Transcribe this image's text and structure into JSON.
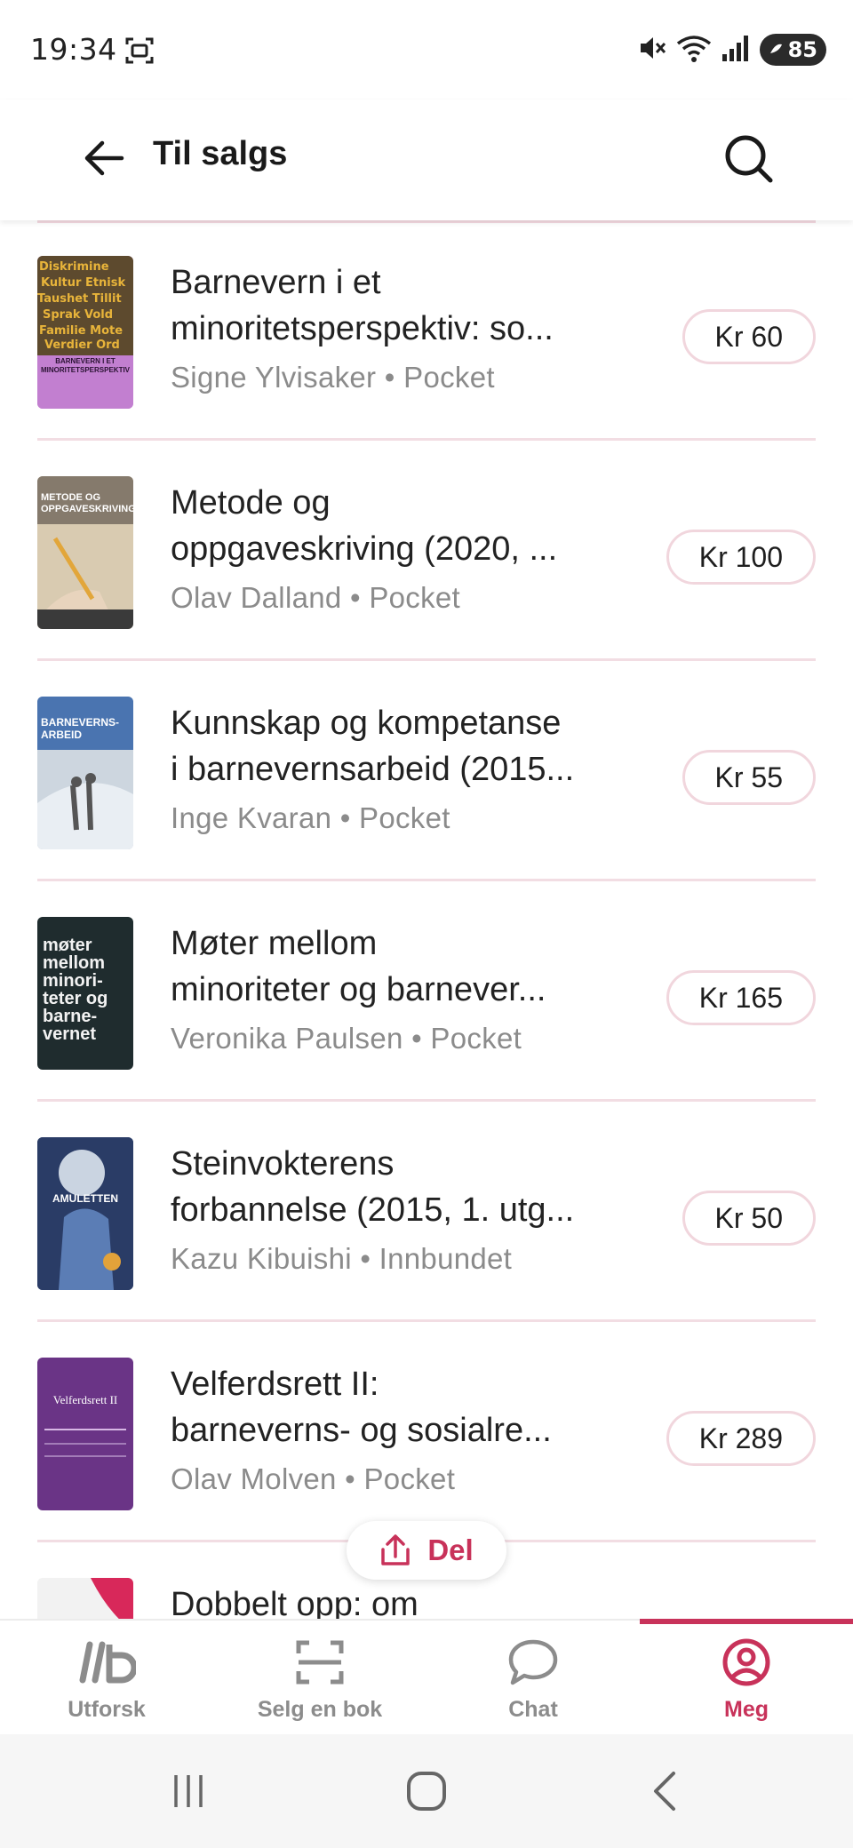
{
  "status_bar": {
    "time": "19:34",
    "battery": "85",
    "icons": [
      "screenshot-icon",
      "mute-icon",
      "wifi-icon",
      "signal-icon",
      "battery-icon"
    ]
  },
  "header": {
    "title": "Til salgs",
    "back_icon": "arrow-left-icon",
    "search_icon": "search-icon"
  },
  "books": [
    {
      "title": "Barnevern i et\nminoritetsperspektiv: so...",
      "author": "Signe Ylvisaker",
      "format": "Pocket",
      "subtitle": "Signe Ylvisaker • Pocket",
      "price": "Kr 60",
      "cover_color": "#b26cc4"
    },
    {
      "title": "Metode og\noppgaveskriving (2020, ...",
      "author": "Olav Dalland",
      "format": "Pocket",
      "subtitle": "Olav Dalland • Pocket",
      "price": "Kr 100",
      "cover_color": "#6d5f4e"
    },
    {
      "title": "Kunnskap og kompetanse\ni barnevernsarbeid (2015...",
      "author": "Inge Kvaran",
      "format": "Pocket",
      "subtitle": "Inge Kvaran • Pocket",
      "price": "Kr 55",
      "cover_color": "#4d79b8"
    },
    {
      "title": "Møter mellom\nminoriteter og barnever...",
      "author": "Veronika Paulsen",
      "format": "Pocket",
      "subtitle": "Veronika Paulsen • Pocket",
      "price": "Kr 165",
      "cover_color": "#1e2a2c"
    },
    {
      "title": "Steinvokterens\nforbannelse (2015, 1. utg...",
      "author": "Kazu Kibuishi",
      "format": "Innbundet",
      "subtitle": "Kazu Kibuishi • Innbundet",
      "price": "Kr 50",
      "cover_color": "#24375e"
    },
    {
      "title": "Velferdsrett II:\nbarneverns- og sosialre...",
      "author": "Olav Molven",
      "format": "Pocket",
      "subtitle": "Olav Molven • Pocket",
      "price": "Kr 289",
      "cover_color": "#6a3486"
    },
    {
      "title": "Dobbelt opp: om",
      "author": "",
      "format": "",
      "subtitle": "",
      "price": "",
      "cover_color": "#f0f0f0"
    }
  ],
  "cover_texts": {
    "book1": "BARNEVERN I ET MINORITETSPERSPEKTIV",
    "book2": "METODE OG OPPGAVESKRIVING",
    "book3": "BARNEVERNS-ARBEID",
    "book4": "møter mellom minori-teter og barne-vernet",
    "book5": "AMULETTEN",
    "book6": "Velferdsrett II"
  },
  "share": {
    "label": "Del",
    "icon": "share-icon"
  },
  "bottom_nav": {
    "items": [
      {
        "label": "Utforsk",
        "icon": "ilb-logo-icon",
        "active": false
      },
      {
        "label": "Selg en bok",
        "icon": "scan-icon",
        "active": false
      },
      {
        "label": "Chat",
        "icon": "chat-bubble-icon",
        "active": false
      },
      {
        "label": "Meg",
        "icon": "profile-icon",
        "active": true
      }
    ]
  },
  "colors": {
    "accent": "#c8325a",
    "divider": "#f2dde3",
    "muted": "#8b8b8b"
  }
}
